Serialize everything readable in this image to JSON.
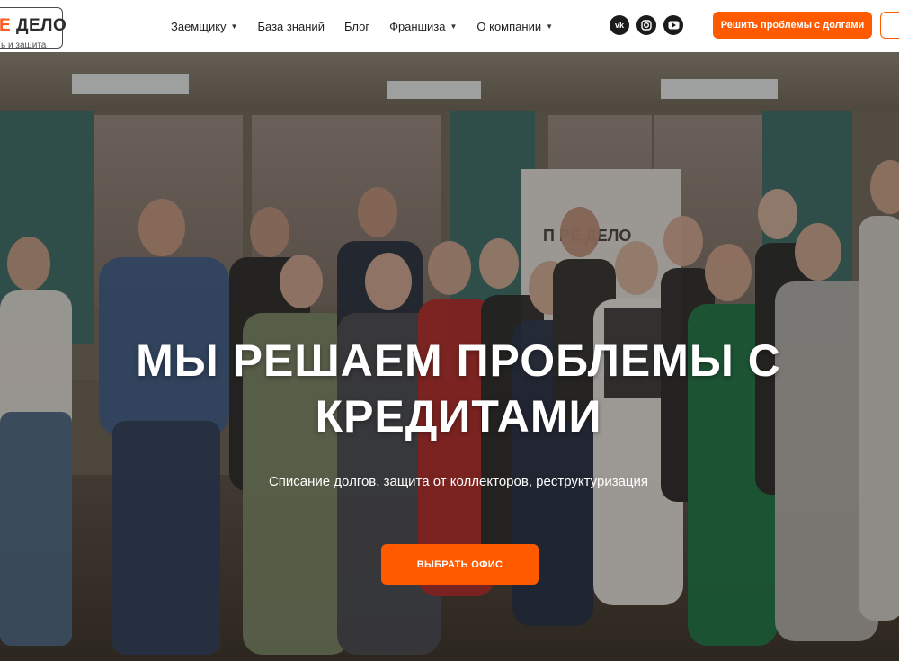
{
  "header": {
    "logo_accent": "Е",
    "logo_text": "ДЕЛО",
    "logo_sub": "ь и защита",
    "nav": [
      {
        "label": "Заемщику",
        "dropdown": true
      },
      {
        "label": "База знаний",
        "dropdown": false
      },
      {
        "label": "Блог",
        "dropdown": false
      },
      {
        "label": "Франшиза",
        "dropdown": true
      },
      {
        "label": "О компании",
        "dropdown": true
      }
    ],
    "socials": [
      {
        "icon": "vk-icon",
        "text": "vk"
      },
      {
        "icon": "instagram-icon",
        "text": ""
      },
      {
        "icon": "youtube-icon",
        "text": ""
      }
    ],
    "cta_label": "Решить проблемы с долгами"
  },
  "hero": {
    "title_line1": "МЫ РЕШАЕМ ПРОБЛЕМЫ С",
    "title_line2": "КРЕДИТАМИ",
    "subtitle": "Списание долгов, защита от коллекторов, реструктуризация",
    "cta_label": "ВЫБРАТЬ ОФИС",
    "banner_text": "П    РЕ ДЕЛО"
  },
  "colors": {
    "accent": "#ff5a00",
    "header_bg": "#ffffff",
    "text_dark": "#1e1e1e"
  }
}
